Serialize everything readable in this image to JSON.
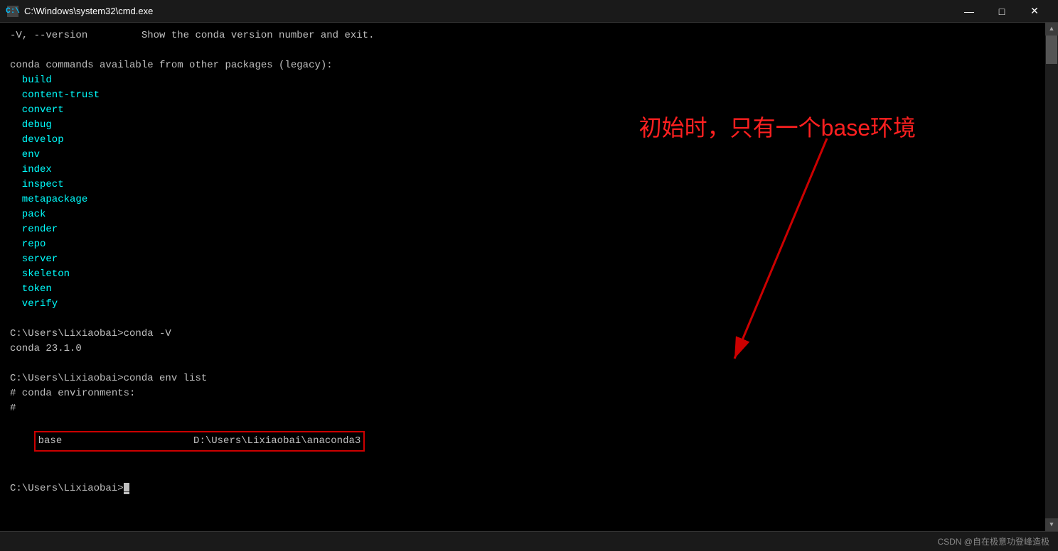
{
  "titlebar": {
    "icon": "C:\\",
    "title": "C:\\Windows\\system32\\cmd.exe",
    "minimize": "—",
    "maximize": "□",
    "close": "✕"
  },
  "terminal": {
    "lines": [
      {
        "text": "-V, --version         Show the conda version number and exit.",
        "class": "normal"
      },
      {
        "text": "",
        "class": "normal"
      },
      {
        "text": "conda commands available from other packages (legacy):",
        "class": "normal"
      },
      {
        "text": "  build",
        "class": "cyan"
      },
      {
        "text": "  content-trust",
        "class": "cyan"
      },
      {
        "text": "  convert",
        "class": "cyan"
      },
      {
        "text": "  debug",
        "class": "cyan"
      },
      {
        "text": "  develop",
        "class": "cyan"
      },
      {
        "text": "  env",
        "class": "cyan"
      },
      {
        "text": "  index",
        "class": "cyan"
      },
      {
        "text": "  inspect",
        "class": "cyan"
      },
      {
        "text": "  metapackage",
        "class": "cyan"
      },
      {
        "text": "  pack",
        "class": "cyan"
      },
      {
        "text": "  render",
        "class": "cyan"
      },
      {
        "text": "  repo",
        "class": "cyan"
      },
      {
        "text": "  server",
        "class": "cyan"
      },
      {
        "text": "  skeleton",
        "class": "cyan"
      },
      {
        "text": "  token",
        "class": "cyan"
      },
      {
        "text": "  verify",
        "class": "cyan"
      },
      {
        "text": "",
        "class": "normal"
      },
      {
        "text": "C:\\Users\\Lixiaobai>conda -V",
        "class": "normal"
      },
      {
        "text": "conda 23.1.0",
        "class": "normal"
      },
      {
        "text": "",
        "class": "normal"
      },
      {
        "text": "C:\\Users\\Lixiaobai>conda env list",
        "class": "normal"
      },
      {
        "text": "# conda environments:",
        "class": "normal"
      },
      {
        "text": "#",
        "class": "normal"
      }
    ],
    "base_line": "base                      D:\\Users\\Lixiaobai\\anaconda3",
    "cursor_line": "C:\\Users\\Lixiaobai>_"
  },
  "annotation": {
    "text": "初始时，只有一个base环境"
  },
  "statusbar": {
    "text": "CSDN @自在极意功登峰造极"
  }
}
